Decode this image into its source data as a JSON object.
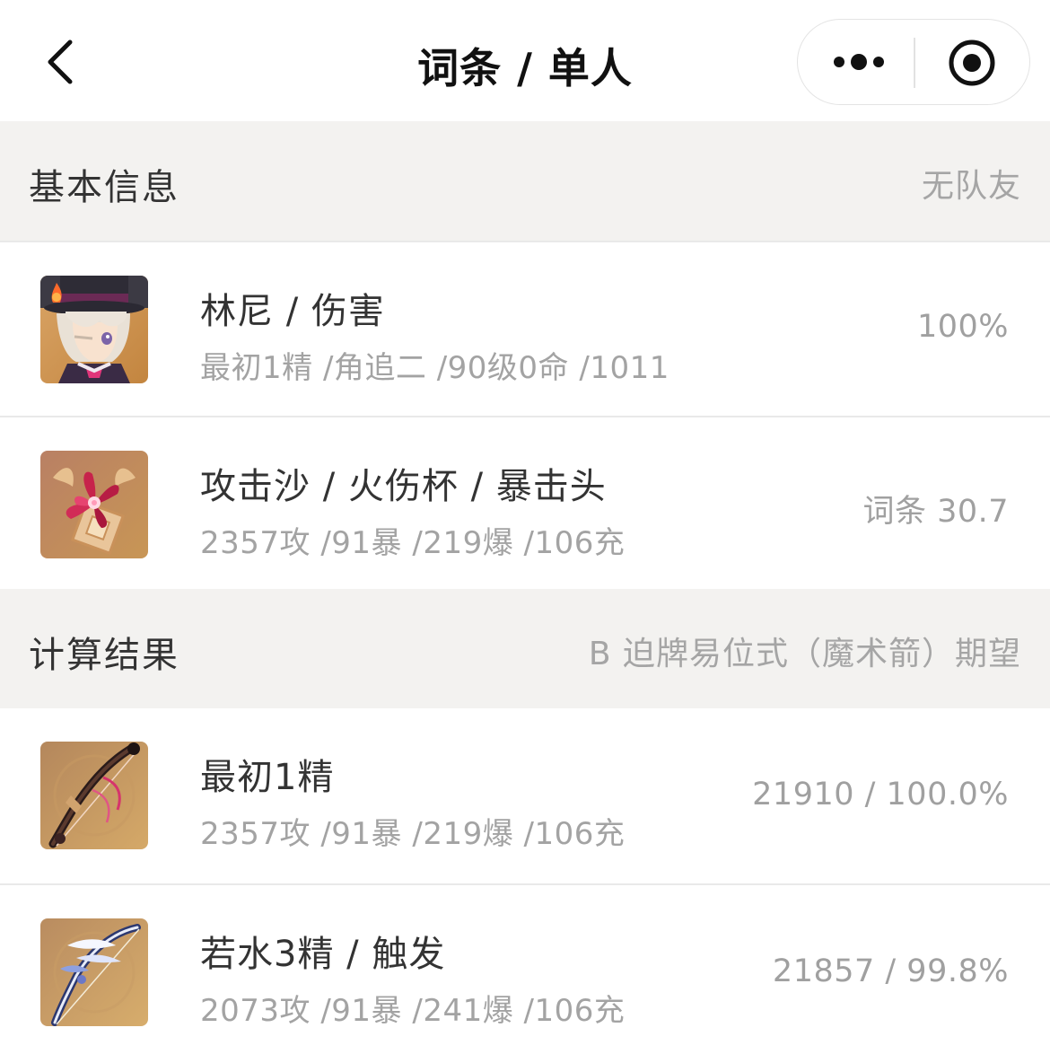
{
  "navbar": {
    "title": "词条 / 单人",
    "back_icon": "chevron-left-icon",
    "more_icon": "more-dots-icon",
    "close_icon": "target-circle-icon"
  },
  "basic_info": {
    "title": "基本信息",
    "subtitle": "无队友",
    "rows": [
      {
        "icon": "character-lyney-avatar",
        "title": "林尼 / 伤害",
        "subtitle": "最初1精 /角追二 /90级0命 /1011",
        "value": "100%"
      },
      {
        "icon": "artifact-flower-icon",
        "title": "攻击沙 / 火伤杯 / 暴击头",
        "subtitle": "2357攻 /91暴 /219爆 /106充",
        "value": "词条 30.7"
      }
    ]
  },
  "results": {
    "title": "计算结果",
    "subtitle": "B 迫牌易位式（魔术箭）期望",
    "rows": [
      {
        "icon": "bow-weapon-icon",
        "title": "最初1精",
        "subtitle": "2357攻 /91暴 /219爆 /106充",
        "value": "21910 / 100.0%"
      },
      {
        "icon": "bow-weapon-icon",
        "title": "若水3精 / 触发",
        "subtitle": "2073攻 /91暴 /241爆 /106充",
        "value": "21857 / 99.8%"
      }
    ]
  },
  "colors": {
    "section_bg": "#f3f2f0",
    "primary_text": "#333333",
    "secondary_text": "#a3a3a3",
    "thumb_bg": "#d8a766"
  }
}
